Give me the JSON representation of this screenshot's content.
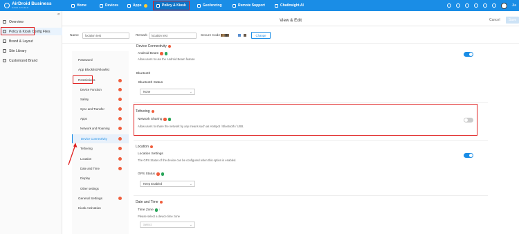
{
  "brand": {
    "name": "AirDroid Business",
    "subtitle": "SAND STUDIO"
  },
  "topnav": [
    {
      "label": "Home",
      "icon": "home-icon"
    },
    {
      "label": "Devices",
      "icon": "devices-icon"
    },
    {
      "label": "Apps",
      "icon": "apps-icon"
    },
    {
      "label": "Policy & Kiosk",
      "icon": "policy-icon"
    },
    {
      "label": "Geofencing",
      "icon": "geofencing-icon"
    },
    {
      "label": "Remote Support",
      "icon": "remote-support-icon"
    },
    {
      "label": "ChatInsight.AI",
      "icon": "chatinsight-icon"
    }
  ],
  "user": {
    "name": "Jia"
  },
  "sidebar": {
    "items": [
      {
        "label": "Overview",
        "icon": "overview-icon"
      },
      {
        "label": "Policy & Kiosk Config Files",
        "icon": "config-icon"
      },
      {
        "label": "Brand & Layout",
        "icon": "brand-icon"
      },
      {
        "label": "Site Library",
        "icon": "library-icon"
      },
      {
        "label": "Customized Brand",
        "icon": "custom-brand-icon"
      }
    ]
  },
  "header": {
    "title": "View & Edit",
    "cancel": "Cancel",
    "save": "Save"
  },
  "form": {
    "name_label": "Name",
    "name_value": "location test",
    "remark_label": "Remark",
    "remark_value": "location test",
    "secure_label": "Secure Code",
    "change_label": "Change"
  },
  "menu": {
    "items": [
      {
        "label": "Password",
        "level": "top"
      },
      {
        "label": "App Blocklist/Allowlist",
        "level": "top"
      },
      {
        "label": "Restrictions",
        "level": "top"
      },
      {
        "label": "Device Function",
        "level": "sub"
      },
      {
        "label": "Safety",
        "level": "sub"
      },
      {
        "label": "Sync and Transfer",
        "level": "sub"
      },
      {
        "label": "Apps",
        "level": "sub"
      },
      {
        "label": "Network and Roaming",
        "level": "sub"
      },
      {
        "label": "Device Connectivity",
        "level": "sub"
      },
      {
        "label": "Tethering",
        "level": "sub"
      },
      {
        "label": "Location",
        "level": "sub"
      },
      {
        "label": "Date and Time",
        "level": "sub"
      },
      {
        "label": "Display",
        "level": "sub"
      },
      {
        "label": "Other settings",
        "level": "sub"
      },
      {
        "label": "General Settings",
        "level": "top"
      },
      {
        "label": "Kiosk Activation",
        "level": "top"
      }
    ]
  },
  "content": {
    "device_connectivity": {
      "title": "Device Connectivity",
      "android_beam_label": "Android Beam",
      "android_beam_desc": "Allow users to use the Android Beam feature",
      "android_beam_on": true,
      "bluetooth_title": "Bluetooth",
      "bluetooth_status_label": "Bluetooth Status",
      "bluetooth_status_value": "None"
    },
    "tethering": {
      "title": "Tethering",
      "network_sharing_label": "Network Sharing",
      "network_sharing_desc": "Allow users to share the network by any means such as Hotspot / Bluetooth / USB.",
      "network_sharing_on": false
    },
    "location": {
      "title": "Location",
      "settings_label": "Location Settings",
      "settings_desc": "The GPS Status of the device can be configured when this option is enabled.",
      "settings_on": true,
      "gps_label": "GPS Status",
      "gps_value": "Keep Enabled"
    },
    "date_time": {
      "title": "Date and Time",
      "timezone_label": "Time Zone",
      "timezone_desc": "Please select a device time zone",
      "timezone_placeholder": "Select"
    }
  },
  "colors": {
    "primary": "#1a8de6",
    "highlight": "#e02020",
    "badge": "#f05d3c"
  }
}
